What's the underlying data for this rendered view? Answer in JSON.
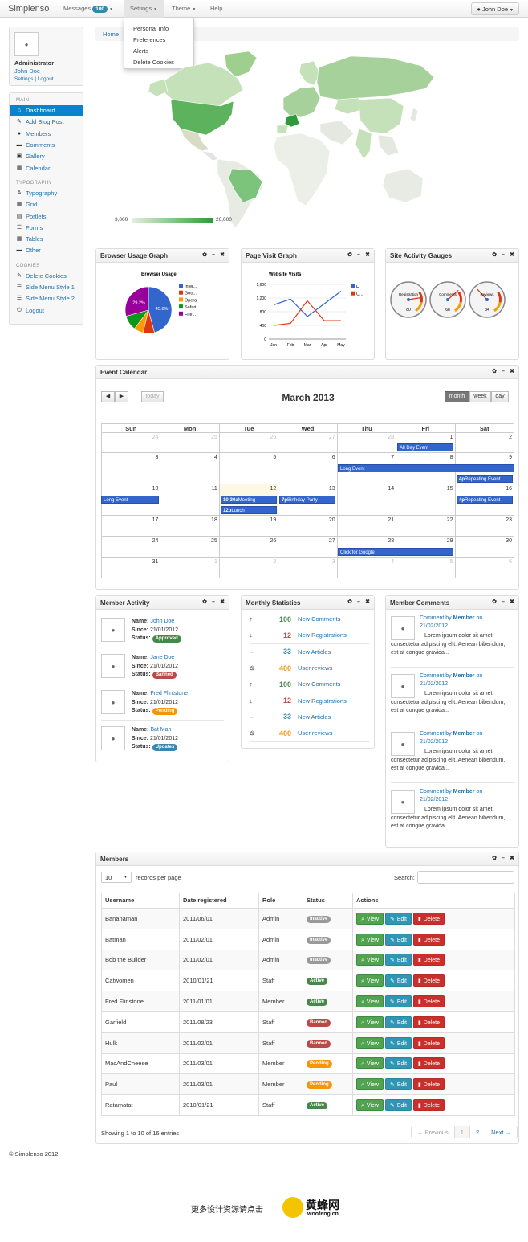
{
  "nav": {
    "brand": "Simplenso",
    "messages_label": "Messages",
    "messages_count": "100",
    "settings_label": "Settings",
    "theme_label": "Theme",
    "help_label": "Help",
    "user_label": "John Doe",
    "settings_menu": [
      "Personal Info",
      "Preferences",
      "Alerts",
      "Delete Cookies"
    ]
  },
  "user": {
    "role": "Administrator",
    "name": "John Doe",
    "settings_link": "Settings",
    "logout_link": "Logout"
  },
  "sidebar": {
    "main_head": "MAIN",
    "main": [
      {
        "label": "Dashboard",
        "icon": "home-icon",
        "glyph": "⌂"
      },
      {
        "label": "Add Blog Post",
        "icon": "edit-icon",
        "glyph": "✎"
      },
      {
        "label": "Members",
        "icon": "user-icon",
        "glyph": "●"
      },
      {
        "label": "Comments",
        "icon": "comment-icon",
        "glyph": "▬"
      },
      {
        "label": "Gallery",
        "icon": "picture-icon",
        "glyph": "▣"
      },
      {
        "label": "Calendar",
        "icon": "calendar-icon",
        "glyph": "▦"
      }
    ],
    "typo_head": "TYPOGRAPHY",
    "typo": [
      {
        "label": "Typography",
        "icon": "font-icon",
        "glyph": "A"
      },
      {
        "label": "Grid",
        "icon": "grid-icon",
        "glyph": "▦"
      },
      {
        "label": "Portlets",
        "icon": "portlet-icon",
        "glyph": "▤"
      },
      {
        "label": "Forms",
        "icon": "forms-icon",
        "glyph": "☰"
      },
      {
        "label": "Tables",
        "icon": "table-icon",
        "glyph": "▦"
      },
      {
        "label": "Other",
        "icon": "folder-icon",
        "glyph": "▬"
      }
    ],
    "cookies_head": "COOKIES",
    "cookies": [
      {
        "label": "Delete Cookies",
        "icon": "wrench-icon",
        "glyph": "✎"
      },
      {
        "label": "Side Menu Style 1",
        "icon": "list-icon",
        "glyph": "☰"
      },
      {
        "label": "Side Menu Style 2",
        "icon": "list-icon",
        "glyph": "☰"
      },
      {
        "label": "Logout",
        "icon": "power-icon",
        "glyph": "⏻"
      }
    ]
  },
  "breadcrumb": {
    "home": "Home"
  },
  "map": {
    "legend_min": "3,000",
    "legend_max": "20,000"
  },
  "widgets": {
    "browser_title": "Browser Usage Graph",
    "pagevisit_title": "Page Visit Graph",
    "gauges_title": "Site Activity Gauges",
    "calendar_title": "Event Calendar",
    "member_activity_title": "Member Activity",
    "monthly_title": "Monthly Statistics",
    "member_comments_title": "Member Comments",
    "members_title": "Members"
  },
  "chart_data": [
    {
      "type": "pie",
      "title": "Browser Usage",
      "categories": [
        "Inter...",
        "Goo...",
        "Opera",
        "Safari",
        "Fire..."
      ],
      "values": [
        45.8,
        8.0,
        6.5,
        10.5,
        29.2
      ],
      "colors": [
        "#3366cc",
        "#dc3912",
        "#ff9900",
        "#109618",
        "#990099"
      ],
      "labels": [
        "45.8%",
        "",
        "",
        "",
        "29.2%"
      ]
    },
    {
      "type": "line",
      "title": "Website Visits",
      "categories": [
        "Jan",
        "Feb",
        "Mar",
        "Apr",
        "May"
      ],
      "yticks": [
        "0",
        "400",
        "800",
        "1,200",
        "1,600"
      ],
      "ylim": [
        0,
        1600
      ],
      "series": [
        {
          "name": "H...",
          "color": "#3366cc",
          "values": [
            1000,
            1170,
            660,
            1030,
            1400
          ]
        },
        {
          "name": "U...",
          "color": "#dc3912",
          "values": [
            400,
            460,
            1120,
            540,
            540
          ]
        }
      ]
    }
  ],
  "gauges": [
    {
      "label": "Registration",
      "value": "80"
    },
    {
      "label": "Comments",
      "value": "68"
    },
    {
      "label": "Reviews",
      "value": "34"
    }
  ],
  "calendar": {
    "title": "March 2013",
    "today_label": "today",
    "prev": "◀",
    "next": "▶",
    "views": [
      "month",
      "week",
      "day"
    ],
    "days": [
      "Sun",
      "Mon",
      "Tue",
      "Wed",
      "Thu",
      "Fri",
      "Sat"
    ],
    "weeks": [
      [
        "24",
        "25",
        "26",
        "27",
        "28",
        "1",
        "2"
      ],
      [
        "3",
        "4",
        "5",
        "6",
        "7",
        "8",
        "9"
      ],
      [
        "10",
        "11",
        "12",
        "13",
        "14",
        "15",
        "16"
      ],
      [
        "17",
        "18",
        "19",
        "20",
        "21",
        "22",
        "23"
      ],
      [
        "24",
        "25",
        "26",
        "27",
        "28",
        "29",
        "30"
      ],
      [
        "31",
        "1",
        "2",
        "3",
        "4",
        "5",
        "6"
      ]
    ],
    "events": {
      "all_day": "All Day Event",
      "long1": "Long Event",
      "repeat1_time": "4p",
      "repeat1": "Repeating Event",
      "long2": "Long Event",
      "meeting_time": "10:30a",
      "meeting": "Meeting",
      "lunch_time": "12p",
      "lunch": "Lunch",
      "party_time": "7p",
      "party": "Birthday Party",
      "repeat2_time": "4p",
      "repeat2": "Repeating Event",
      "google": "Click for Google"
    }
  },
  "member_activity": {
    "labels": {
      "name": "Name:",
      "since": "Since:",
      "status": "Status:"
    },
    "items": [
      {
        "name": "John Doe",
        "since": "21/01/2012",
        "status": "Approved"
      },
      {
        "name": "Jane Doe",
        "since": "21/01/2012",
        "status": "Banned"
      },
      {
        "name": "Fred Flintstone",
        "since": "21/01/2012",
        "status": "Pending"
      },
      {
        "name": "Bat Man",
        "since": "21/01/2012",
        "status": "Updates"
      }
    ]
  },
  "monthly": [
    {
      "icon": "arrow-up-icon",
      "glyph": "↑",
      "value": "100",
      "color": "#468847",
      "label": "New Comments"
    },
    {
      "icon": "arrow-down-icon",
      "glyph": "↓",
      "value": "12",
      "color": "#b94a48",
      "label": "New Registrations"
    },
    {
      "icon": "minus-icon",
      "glyph": "–",
      "value": "33",
      "color": "#3a87ad",
      "label": "New Articles"
    },
    {
      "icon": "fire-icon",
      "glyph": "♨",
      "value": "400",
      "color": "#f89406",
      "label": "User reviews"
    },
    {
      "icon": "arrow-up-icon",
      "glyph": "↑",
      "value": "100",
      "color": "#468847",
      "label": "New Comments"
    },
    {
      "icon": "arrow-down-icon",
      "glyph": "↓",
      "value": "12",
      "color": "#b94a48",
      "label": "New Registrations"
    },
    {
      "icon": "minus-icon",
      "glyph": "–",
      "value": "33",
      "color": "#3a87ad",
      "label": "New Articles"
    },
    {
      "icon": "fire-icon",
      "glyph": "♨",
      "value": "400",
      "color": "#f89406",
      "label": "User reviews"
    }
  ],
  "comments": {
    "prefix": "Comment by",
    "author": "Member",
    "on": "on",
    "items": [
      {
        "date": "21/02/2012",
        "text": "Lorem ipsum dolor sit amet, consectetur adipiscing elit. Aenean bibendum, est at congue gravida..."
      },
      {
        "date": "21/02/2012",
        "text": "Lorem ipsum dolor sit amet, consectetur adipiscing elit. Aenean bibendum, est at congue gravida..."
      },
      {
        "date": "21/02/2012",
        "text": "Lorem ipsum dolor sit amet, consectetur adipiscing elit. Aenean bibendum, est at congue gravida..."
      },
      {
        "date": "21/02/2012",
        "text": "Lorem ipsum dolor sit amet, consectetur adipiscing elit. Aenean bibendum, est at congue gravida..."
      }
    ]
  },
  "members": {
    "per_page_value": "10",
    "per_page_label": "records per page",
    "search_label": "Search:",
    "columns": [
      "Username",
      "Date registered",
      "Role",
      "Status",
      "Actions"
    ],
    "rows": [
      {
        "user": "Bananaman",
        "date": "2011/06/01",
        "role": "Admin",
        "status": "Inactive"
      },
      {
        "user": "Batman",
        "date": "2011/02/01",
        "role": "Admin",
        "status": "Inactive"
      },
      {
        "user": "Bob the Builder",
        "date": "2011/02/01",
        "role": "Admin",
        "status": "Inactive"
      },
      {
        "user": "Catwomen",
        "date": "2010/01/21",
        "role": "Staff",
        "status": "Active"
      },
      {
        "user": "Fred Flinstone",
        "date": "2011/01/01",
        "role": "Member",
        "status": "Active"
      },
      {
        "user": "Garfield",
        "date": "2011/08/23",
        "role": "Staff",
        "status": "Banned"
      },
      {
        "user": "Hulk",
        "date": "2011/02/01",
        "role": "Staff",
        "status": "Banned"
      },
      {
        "user": "MacAndCheese",
        "date": "2011/03/01",
        "role": "Member",
        "status": "Pending"
      },
      {
        "user": "Paul",
        "date": "2011/03/01",
        "role": "Member",
        "status": "Pending"
      },
      {
        "user": "Ratamatat",
        "date": "2010/01/21",
        "role": "Staff",
        "status": "Active"
      }
    ],
    "view_label": "View",
    "edit_label": "Edit",
    "delete_label": "Delete",
    "info": "Showing 1 to 10 of 16 entries",
    "pagination": [
      "← Previous",
      "1",
      "2",
      "Next →"
    ]
  },
  "footer": {
    "copyright": "© Simplenso 2012"
  },
  "promo": {
    "text": "更多设计资源请点击",
    "brand": "黄蜂网",
    "domain": "woofeng.cn"
  }
}
